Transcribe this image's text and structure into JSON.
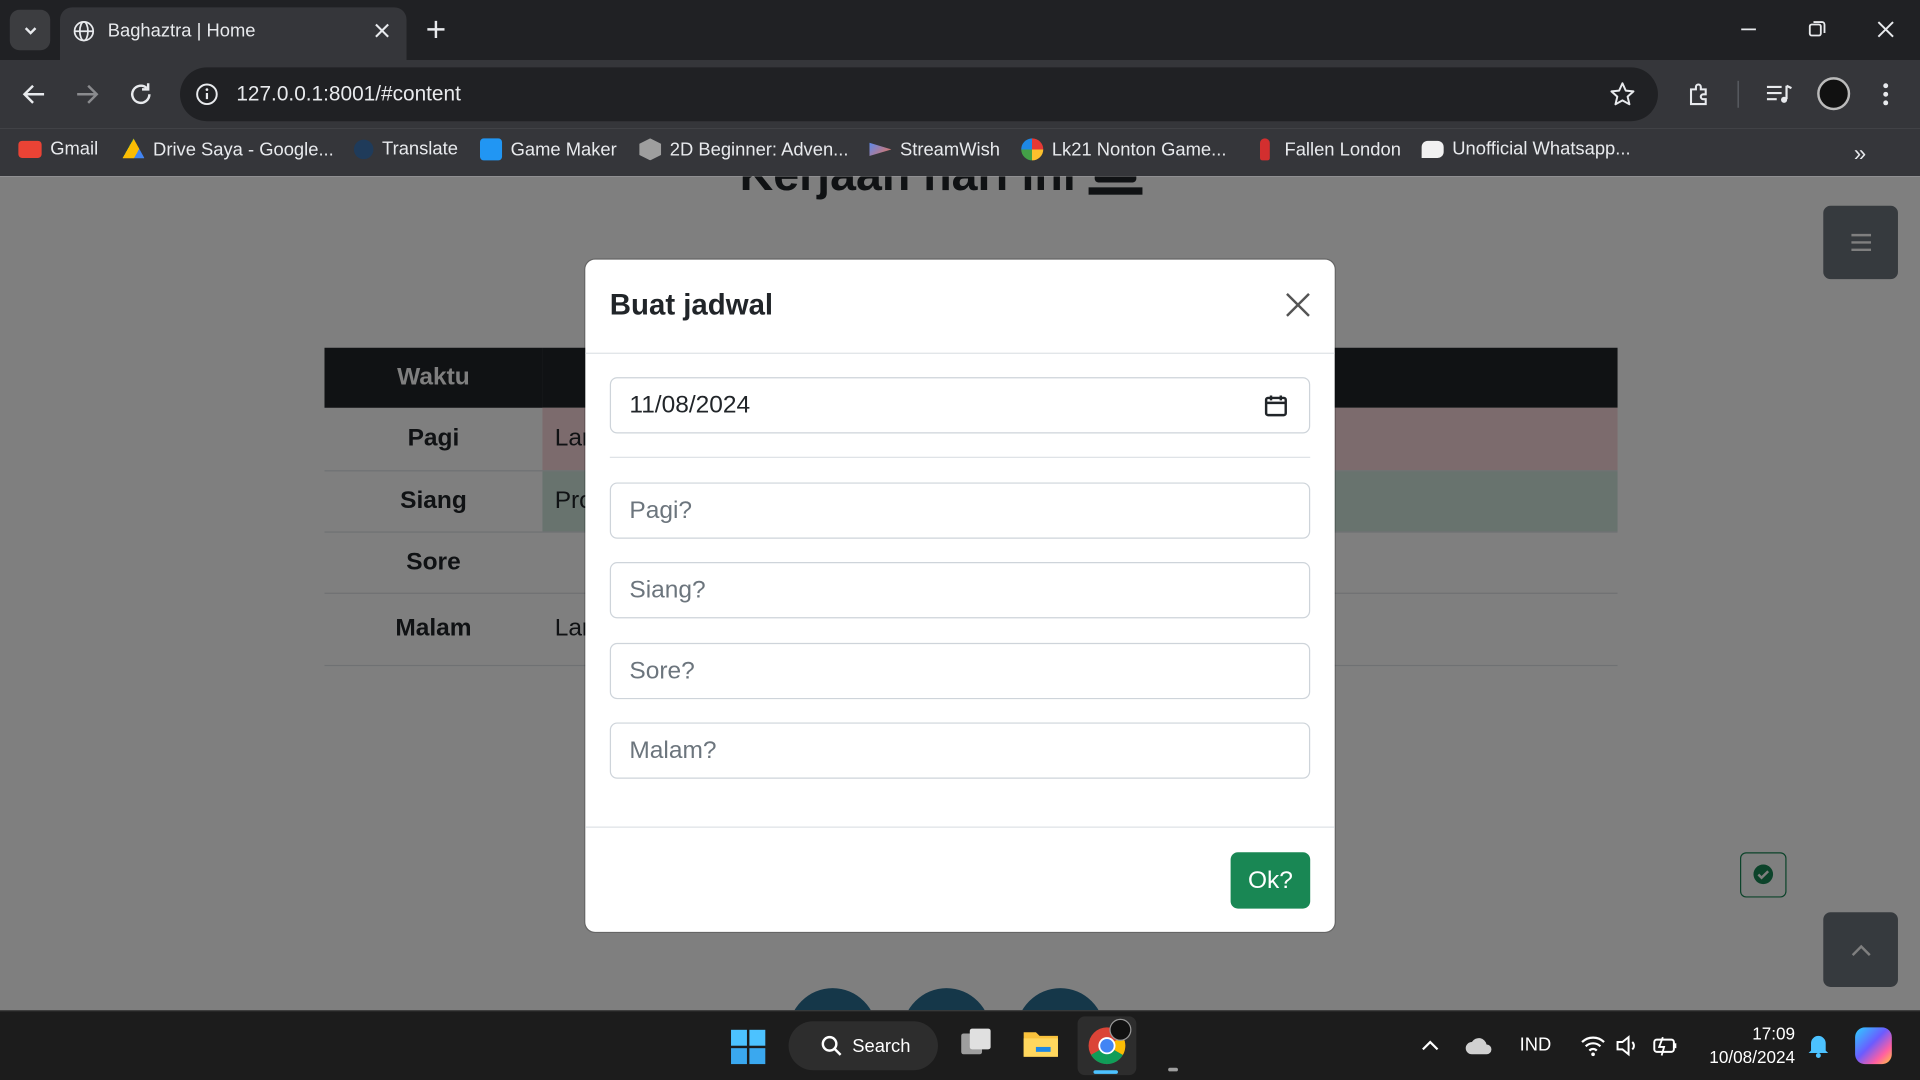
{
  "browser": {
    "tab_title": "Baghaztra | Home",
    "url": "127.0.0.1:8001/#content",
    "bookmarks": [
      {
        "label": "Gmail",
        "icon": "gmail-icon",
        "color": "#ea4335"
      },
      {
        "label": "Drive Saya - Google...",
        "icon": "google-drive-icon",
        "color": "#fbbc04"
      },
      {
        "label": "Translate",
        "icon": "translate-icon",
        "color": "#1a73e8"
      },
      {
        "label": "Game Maker",
        "icon": "game-maker-icon",
        "color": "#2196f3"
      },
      {
        "label": "2D Beginner: Adven...",
        "icon": "unity-icon",
        "color": "#cccccc"
      },
      {
        "label": "StreamWish",
        "icon": "streamwish-icon",
        "color": "#4a8cff"
      },
      {
        "label": "Lk21 Nonton Game...",
        "icon": "lk21-icon",
        "color": "#e53935"
      },
      {
        "label": "Fallen London",
        "icon": "fallen-london-icon",
        "color": "#d32f2f"
      },
      {
        "label": "Unofficial Whatsapp...",
        "icon": "whatsapp-icon",
        "color": "#ffffff"
      }
    ]
  },
  "page": {
    "heading": "Kerjaan hari ini",
    "table": {
      "header": "Waktu",
      "rows": [
        {
          "time": "Pagi",
          "task": "Lar"
        },
        {
          "time": "Siang",
          "task": "Pro"
        },
        {
          "time": "Sore",
          "task": ""
        },
        {
          "time": "Malam",
          "task": "Lar"
        }
      ]
    }
  },
  "modal": {
    "title": "Buat jadwal",
    "date_value": "11/08/2024",
    "placeholders": {
      "pagi": "Pagi?",
      "siang": "Siang?",
      "sore": "Sore?",
      "malam": "Malam?"
    },
    "ok_label": "Ok?"
  },
  "taskbar": {
    "search_label": "Search",
    "language": "IND",
    "time": "17:09",
    "date": "10/08/2024"
  },
  "colors": {
    "success": "#198754",
    "danger_subtle": "#f8d7da",
    "success_subtle": "#d1e7dd",
    "dark": "#212529"
  }
}
